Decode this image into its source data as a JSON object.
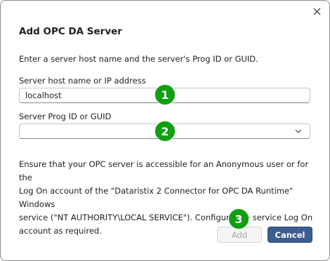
{
  "dialog": {
    "title": "Add OPC DA Server",
    "intro": "Enter a server host name and the server's Prog ID or GUID.",
    "host": {
      "label": "Server host name or IP address",
      "value": "localhost"
    },
    "progid": {
      "label": "Server Prog ID or GUID",
      "value": ""
    },
    "note_lines": [
      "Ensure that your OPC server is accessible for an Anonymous user or for the",
      "Log On account of the \"Dataristix 2 Connector for OPC DA Runtime\" Windows",
      "service (\"NT AUTHORITY\\LOCAL SERVICE\"). Configure the service Log On",
      "account as required."
    ],
    "buttons": {
      "add": "Add",
      "cancel": "Cancel"
    }
  },
  "badges": [
    "1",
    "2",
    "3"
  ],
  "colors": {
    "accent": "#3c5d8f",
    "badge": "#0f9f0f",
    "disabled_text": "#a8a8a8"
  },
  "icons": {
    "close": "close-icon",
    "dropdown": "chevron-down-icon"
  }
}
